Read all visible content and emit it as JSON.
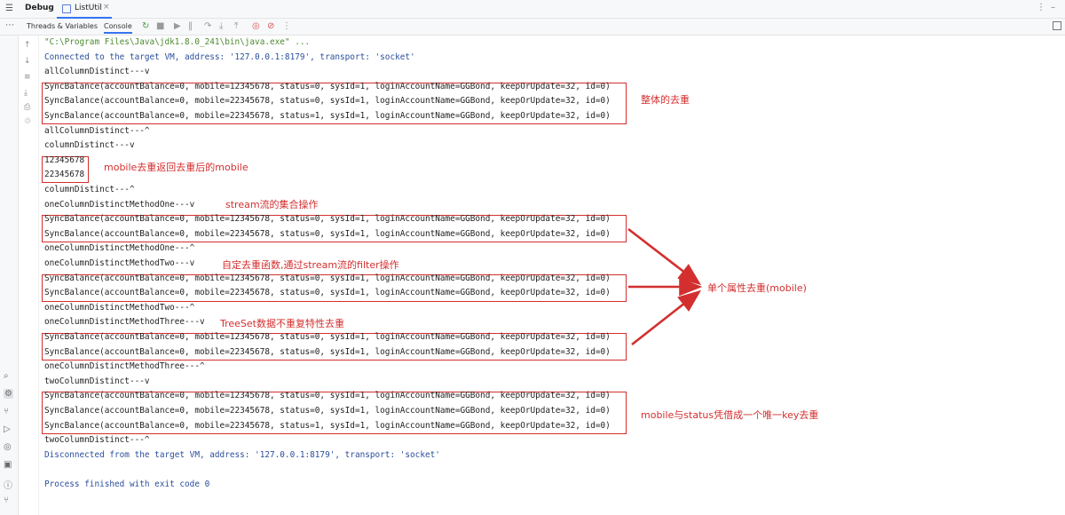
{
  "window": {
    "title": "Debug",
    "tab_label": "ListUtil",
    "close_glyph": "×",
    "subtabs": [
      "Threads & Variables",
      "Console"
    ]
  },
  "console": {
    "lines": [
      {
        "text": "\"C:\\Program Files\\Java\\jdk1.8.0_241\\bin\\java.exe\" ...",
        "style": "green"
      },
      {
        "text": "Connected to the target VM, address: '127.0.0.1:8179', transport: 'socket'",
        "style": "sys"
      },
      {
        "text": "allColumnDistinct---v",
        "style": "normal"
      },
      {
        "text": "SyncBalance(accountBalance=0, mobile=12345678, status=0, sysId=1, loginAccountName=GGBond, keepOrUpdate=32, id=0)",
        "style": "normal"
      },
      {
        "text": "SyncBalance(accountBalance=0, mobile=22345678, status=0, sysId=1, loginAccountName=GGBond, keepOrUpdate=32, id=0)",
        "style": "normal"
      },
      {
        "text": "SyncBalance(accountBalance=0, mobile=22345678, status=1, sysId=1, loginAccountName=GGBond, keepOrUpdate=32, id=0)",
        "style": "normal"
      },
      {
        "text": "allColumnDistinct---^",
        "style": "normal"
      },
      {
        "text": "columnDistinct---v",
        "style": "normal"
      },
      {
        "text": "12345678",
        "style": "normal"
      },
      {
        "text": "22345678",
        "style": "normal"
      },
      {
        "text": "columnDistinct---^",
        "style": "normal"
      },
      {
        "text": "oneColumnDistinctMethodOne---v",
        "style": "normal"
      },
      {
        "text": "SyncBalance(accountBalance=0, mobile=12345678, status=0, sysId=1, loginAccountName=GGBond, keepOrUpdate=32, id=0)",
        "style": "normal"
      },
      {
        "text": "SyncBalance(accountBalance=0, mobile=22345678, status=0, sysId=1, loginAccountName=GGBond, keepOrUpdate=32, id=0)",
        "style": "normal"
      },
      {
        "text": "oneColumnDistinctMethodOne---^",
        "style": "normal"
      },
      {
        "text": "oneColumnDistinctMethodTwo---v",
        "style": "normal"
      },
      {
        "text": "SyncBalance(accountBalance=0, mobile=12345678, status=0, sysId=1, loginAccountName=GGBond, keepOrUpdate=32, id=0)",
        "style": "normal"
      },
      {
        "text": "SyncBalance(accountBalance=0, mobile=22345678, status=0, sysId=1, loginAccountName=GGBond, keepOrUpdate=32, id=0)",
        "style": "normal"
      },
      {
        "text": "oneColumnDistinctMethodTwo---^",
        "style": "normal"
      },
      {
        "text": "oneColumnDistinctMethodThree---v",
        "style": "normal"
      },
      {
        "text": "SyncBalance(accountBalance=0, mobile=12345678, status=0, sysId=1, loginAccountName=GGBond, keepOrUpdate=32, id=0)",
        "style": "normal"
      },
      {
        "text": "SyncBalance(accountBalance=0, mobile=22345678, status=0, sysId=1, loginAccountName=GGBond, keepOrUpdate=32, id=0)",
        "style": "normal"
      },
      {
        "text": "oneColumnDistinctMethodThree---^",
        "style": "normal"
      },
      {
        "text": "twoColumnDistinct---v",
        "style": "normal"
      },
      {
        "text": "SyncBalance(accountBalance=0, mobile=12345678, status=0, sysId=1, loginAccountName=GGBond, keepOrUpdate=32, id=0)",
        "style": "normal"
      },
      {
        "text": "SyncBalance(accountBalance=0, mobile=22345678, status=0, sysId=1, loginAccountName=GGBond, keepOrUpdate=32, id=0)",
        "style": "normal"
      },
      {
        "text": "SyncBalance(accountBalance=0, mobile=22345678, status=1, sysId=1, loginAccountName=GGBond, keepOrUpdate=32, id=0)",
        "style": "normal"
      },
      {
        "text": "twoColumnDistinct---^",
        "style": "normal"
      },
      {
        "text": "Disconnected from the target VM, address: '127.0.0.1:8179', transport: 'socket'",
        "style": "sys"
      },
      {
        "text": "",
        "style": "normal"
      },
      {
        "text": "Process finished with exit code 0",
        "style": "sys"
      }
    ]
  },
  "annotations": {
    "all_column": "整体的去重",
    "mobile_column": "mobile去重返回去重后的mobile",
    "stream": "stream流的集合操作",
    "filter": "自定去重函数,通过stream流的filter操作",
    "treeset": "TreeSet数据不重复特性去重",
    "single_attr": "单个属性去重(mobile)",
    "two_column": "mobile与status凭借成一个唯一key去重"
  },
  "colors": {
    "annotation_red": "#d32f2f",
    "command_green": "#4b8a2f",
    "system_blue": "#2b4f9c",
    "accent_blue": "#3574f0"
  },
  "icons": {
    "top_left": "structure-icon",
    "kebab": "more-vertical-icon"
  }
}
